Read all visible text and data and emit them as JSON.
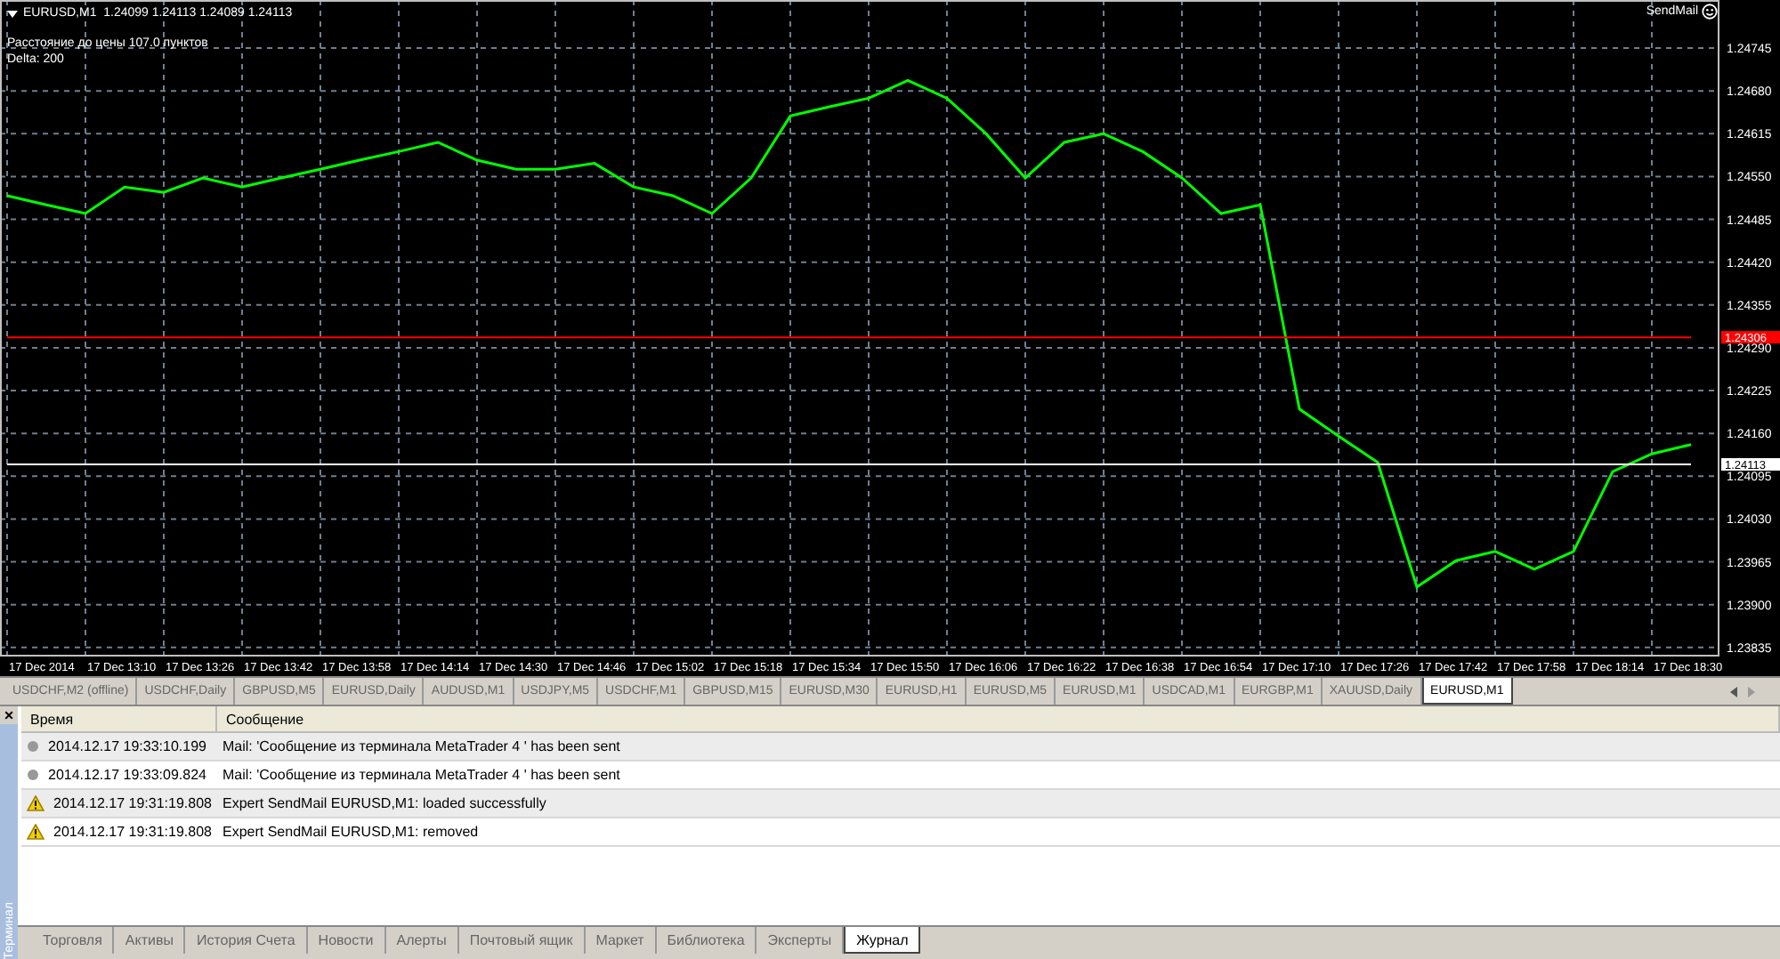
{
  "chart": {
    "symbol_line": "EURUSD,M1  1.24099 1.24113 1.24089 1.24113",
    "indicator_lines": [
      "Расстояние до цены 107.0 пунктов",
      "Delta: 200"
    ],
    "expert": {
      "name": "SendMail"
    },
    "chart_data": {
      "type": "line",
      "grid": true,
      "ylim": [
        1.23824,
        1.24818
      ],
      "yticks": [
        {
          "value": 1.24745,
          "label": "1.24745"
        },
        {
          "value": 1.2468,
          "label": "1.24680"
        },
        {
          "value": 1.24615,
          "label": "1.24615"
        },
        {
          "value": 1.2455,
          "label": "1.24550"
        },
        {
          "value": 1.24485,
          "label": "1.24485"
        },
        {
          "value": 1.2442,
          "label": "1.24420"
        },
        {
          "value": 1.24355,
          "label": "1.24355"
        },
        {
          "value": 1.2429,
          "label": "1.24290"
        },
        {
          "value": 1.24225,
          "label": "1.24225"
        },
        {
          "value": 1.2416,
          "label": "1.24160"
        },
        {
          "value": 1.24095,
          "label": "1.24095"
        },
        {
          "value": 1.2403,
          "label": "1.24030"
        },
        {
          "value": 1.23965,
          "label": "1.23965"
        },
        {
          "value": 1.239,
          "label": "1.23900"
        },
        {
          "value": 1.23835,
          "label": "1.23835"
        }
      ],
      "categories": [
        null,
        "17 Dec 2014",
        null,
        "17 Dec 13:10",
        null,
        "17 Dec 13:26",
        null,
        "17 Dec 13:42",
        null,
        "17 Dec 13:58",
        null,
        "17 Dec 14:14",
        null,
        "17 Dec 14:30",
        null,
        "17 Dec 14:46",
        null,
        "17 Dec 15:02",
        null,
        "17 Dec 15:18",
        null,
        "17 Dec 15:34",
        null,
        "17 Dec 15:50",
        null,
        "17 Dec 16:06",
        null,
        "17 Dec 16:22",
        null,
        "17 Dec 16:38",
        null,
        "17 Dec 16:54",
        null,
        "17 Dec 17:10",
        null,
        "17 Dec 17:26",
        null,
        "17 Dec 17:42",
        null,
        "17 Dec 17:58",
        null,
        "17 Dec 18:14",
        null,
        "17 Dec 18:30"
      ],
      "series": [
        {
          "color": "#00ff00",
          "values": [
            1.24521,
            1.24507,
            1.24494,
            1.24534,
            1.24526,
            1.24548,
            1.24534,
            1.24548,
            1.24561,
            1.24575,
            1.24588,
            1.24602,
            1.24575,
            1.24561,
            1.24561,
            1.2457,
            1.24534,
            1.24521,
            1.24494,
            1.24548,
            1.24642,
            1.24656,
            1.24669,
            1.24696,
            1.24669,
            1.24615,
            1.24548,
            1.24602,
            1.24615,
            1.24588,
            1.24548,
            1.24494,
            1.24507,
            1.24197,
            1.24156,
            1.24116,
            1.23927,
            1.23967,
            1.23981,
            1.23954,
            1.23981,
            1.24102,
            1.24129,
            1.24143
          ]
        },
        {
          "name": "1.24306",
          "color": "#ff0000",
          "values": [
            1.24306,
            1.24306,
            1.24306,
            1.24306,
            1.24306,
            1.24306,
            1.24306,
            1.24306,
            1.24306,
            1.24306,
            1.24306,
            1.24306,
            1.24306,
            1.24306,
            1.24306,
            1.24306,
            1.24306,
            1.24306,
            1.24306,
            1.24306,
            1.24306,
            1.24306,
            1.24306,
            1.24306,
            1.24306,
            1.24306,
            1.24306,
            1.24306,
            1.24306,
            1.24306,
            1.24306,
            1.24306,
            1.24306,
            1.24306,
            1.24306,
            1.24306,
            1.24306,
            1.24306,
            1.24306,
            1.24306,
            1.24306,
            1.24306,
            1.24306,
            1.24306
          ]
        },
        {
          "name": "1.24113",
          "color": "#ffffff",
          "values": [
            1.24113,
            1.24113,
            1.24113,
            1.24113,
            1.24113,
            1.24113,
            1.24113,
            1.24113,
            1.24113,
            1.24113,
            1.24113,
            1.24113,
            1.24113,
            1.24113,
            1.24113,
            1.24113,
            1.24113,
            1.24113,
            1.24113,
            1.24113,
            1.24113,
            1.24113,
            1.24113,
            1.24113,
            1.24113,
            1.24113,
            1.24113,
            1.24113,
            1.24113,
            1.24113,
            1.24113,
            1.24113,
            1.24113,
            1.24113,
            1.24113,
            1.24113,
            1.24113,
            1.24113,
            1.24113,
            1.24113,
            1.24113,
            1.24113,
            1.24113,
            1.24113
          ]
        }
      ]
    }
  },
  "chart_tabs": [
    {
      "label": "USDCHF,M2 (offline)",
      "selected": false
    },
    {
      "label": "USDCHF,Daily",
      "selected": false
    },
    {
      "label": "GBPUSD,M5",
      "selected": false
    },
    {
      "label": "EURUSD,Daily",
      "selected": false
    },
    {
      "label": "AUDUSD,M1",
      "selected": false
    },
    {
      "label": "USDJPY,M5",
      "selected": false
    },
    {
      "label": "USDCHF,M1",
      "selected": false
    },
    {
      "label": "GBPUSD,M15",
      "selected": false
    },
    {
      "label": "EURUSD,M30",
      "selected": false
    },
    {
      "label": "EURUSD,H1",
      "selected": false
    },
    {
      "label": "EURUSD,M5",
      "selected": false
    },
    {
      "label": "EURUSD,M1",
      "selected": false
    },
    {
      "label": "USDCAD,M1",
      "selected": false
    },
    {
      "label": "EURGBP,M1",
      "selected": false
    },
    {
      "label": "XAUUSD,Daily",
      "selected": false
    },
    {
      "label": "EURUSD,M1",
      "selected": true
    }
  ],
  "terminal": {
    "close": "×",
    "side_label": "Терминал",
    "columns": [
      "Время",
      "Сообщение"
    ],
    "rows": [
      {
        "kind": "info",
        "time": "2014.12.17 19:33:10.199",
        "message": "Mail: 'Сообщение из терминала MetaTrader 4 ' has been sent"
      },
      {
        "kind": "info",
        "time": "2014.12.17 19:33:09.824",
        "message": "Mail: 'Сообщение из терминала MetaTrader 4 ' has been sent"
      },
      {
        "kind": "warning",
        "time": "2014.12.17 19:31:19.808",
        "message": "Expert SendMail EURUSD,M1: loaded successfully"
      },
      {
        "kind": "warning",
        "time": "2014.12.17 19:31:19.808",
        "message": "Expert SendMail EURUSD,M1: removed"
      }
    ],
    "tabs": [
      {
        "label": "Торговля",
        "selected": false
      },
      {
        "label": "Активы",
        "selected": false
      },
      {
        "label": "История Счета",
        "selected": false
      },
      {
        "label": "Новости",
        "selected": false
      },
      {
        "label": "Алерты",
        "selected": false
      },
      {
        "label": "Почтовый ящик",
        "selected": false
      },
      {
        "label": "Маркет",
        "selected": false
      },
      {
        "label": "Библиотека",
        "selected": false
      },
      {
        "label": "Эксперты",
        "selected": false
      },
      {
        "label": "Журнал",
        "selected": true
      }
    ]
  }
}
